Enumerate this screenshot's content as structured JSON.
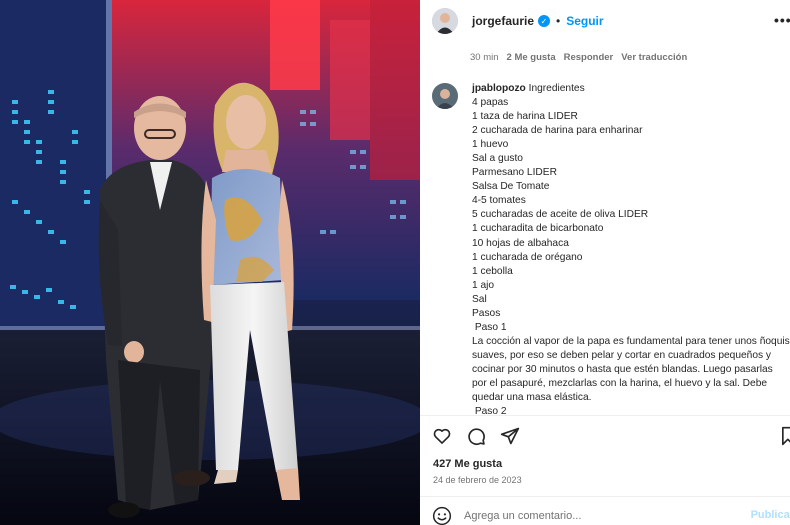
{
  "post": {
    "username": "jorgefaurie",
    "verified_mark": "✓",
    "separator": "•",
    "follow_label": "Seguir",
    "more_label": "•••",
    "likes": "427 Me gusta",
    "date": "24 de febrero de 2023"
  },
  "caption_meta": {
    "time": "30 min",
    "likes": "2 Me gusta",
    "reply": "Responder",
    "translate": "Ver traducción"
  },
  "comment": {
    "username": "jpablopozo",
    "first_line": "Ingredientes",
    "lines": [
      "4 papas",
      "1 taza de harina LIDER",
      "2 cucharada de harina para enharinar",
      "1 huevo",
      "Sal a gusto",
      "Parmesano LIDER",
      "Salsa De Tomate",
      "4-5 tomates",
      "5 cucharadas de aceite de oliva LIDER",
      "1 cucharadita de bicarbonato",
      "10 hojas de albahaca",
      "1 cucharada de orégano",
      "1 cebolla",
      "1 ajo",
      "Sal",
      "Pasos",
      " Paso 1",
      "La cocción al vapor de la papa es fundamental para tener unos ñoquis suaves, por eso se deben pelar y cortar en cuadrados pequeños y cocinar por 30 minutos o hasta que estén blandas. Luego pasarlas por el pasapuré, mezclarlas con la harina, el huevo y la sal. Debe quedar una masa elástica.",
      " Paso 2"
    ]
  },
  "actions": {
    "icons": [
      "heart-icon",
      "comment-icon",
      "share-icon",
      "bookmark-icon"
    ]
  },
  "composer": {
    "placeholder": "Agrega un comentario...",
    "publish_label": "Publicar",
    "emoji_icon": "emoji-icon"
  },
  "colors": {
    "accent": "#0095f6",
    "text": "#262626",
    "muted": "#737373",
    "publish_disabled": "#b2dffc"
  }
}
